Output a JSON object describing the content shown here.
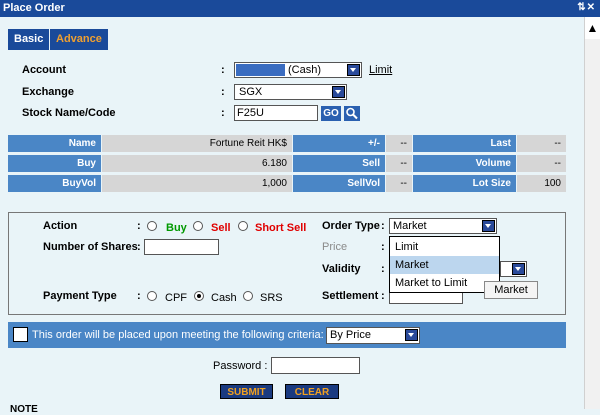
{
  "window": {
    "title": "Place Order"
  },
  "tabs": [
    {
      "label": "Basic"
    },
    {
      "label": "Advance"
    }
  ],
  "form": {
    "account_label": "Account",
    "account_value": "(Cash)",
    "limit_link": "Limit",
    "exchange_label": "Exchange",
    "exchange_value": "SGX",
    "stock_label": "Stock Name/Code",
    "stock_value": "F25U",
    "go_label": "GO"
  },
  "info": {
    "name_label": "Name",
    "name_value": "Fortune Reit HK$",
    "change_label": "+/-",
    "change_value": "--",
    "last_label": "Last",
    "last_value": "--",
    "buy_label": "Buy",
    "buy_value": "6.180",
    "sell_label": "Sell",
    "sell_value": "--",
    "volume_label": "Volume",
    "volume_value": "--",
    "buyvol_label": "BuyVol",
    "buyvol_value": "1,000",
    "sellvol_label": "SellVol",
    "sellvol_value": "--",
    "lotsize_label": "Lot Size",
    "lotsize_value": "100"
  },
  "order": {
    "action_label": "Action",
    "buy": "Buy",
    "sell": "Sell",
    "short_sell": "Short Sell",
    "shares_label": "Number of Shares",
    "payment_label": "Payment Type",
    "cpf": "CPF",
    "cash": "Cash",
    "srs": "SRS",
    "order_type_label": "Order Type",
    "order_type_value": "Market",
    "order_type_options": [
      "Limit",
      "Market",
      "Market to Limit"
    ],
    "price_label": "Price",
    "validity_label": "Validity",
    "settlement_label": "Settlement",
    "tooltip": "Market"
  },
  "criteria": {
    "text": "This order will be placed upon meeting the following criteria:",
    "select_value": "By Price"
  },
  "password_label": "Password :",
  "submit_label": "SUBMIT",
  "clear_label": "CLEAR",
  "note_label": "NOTE"
}
